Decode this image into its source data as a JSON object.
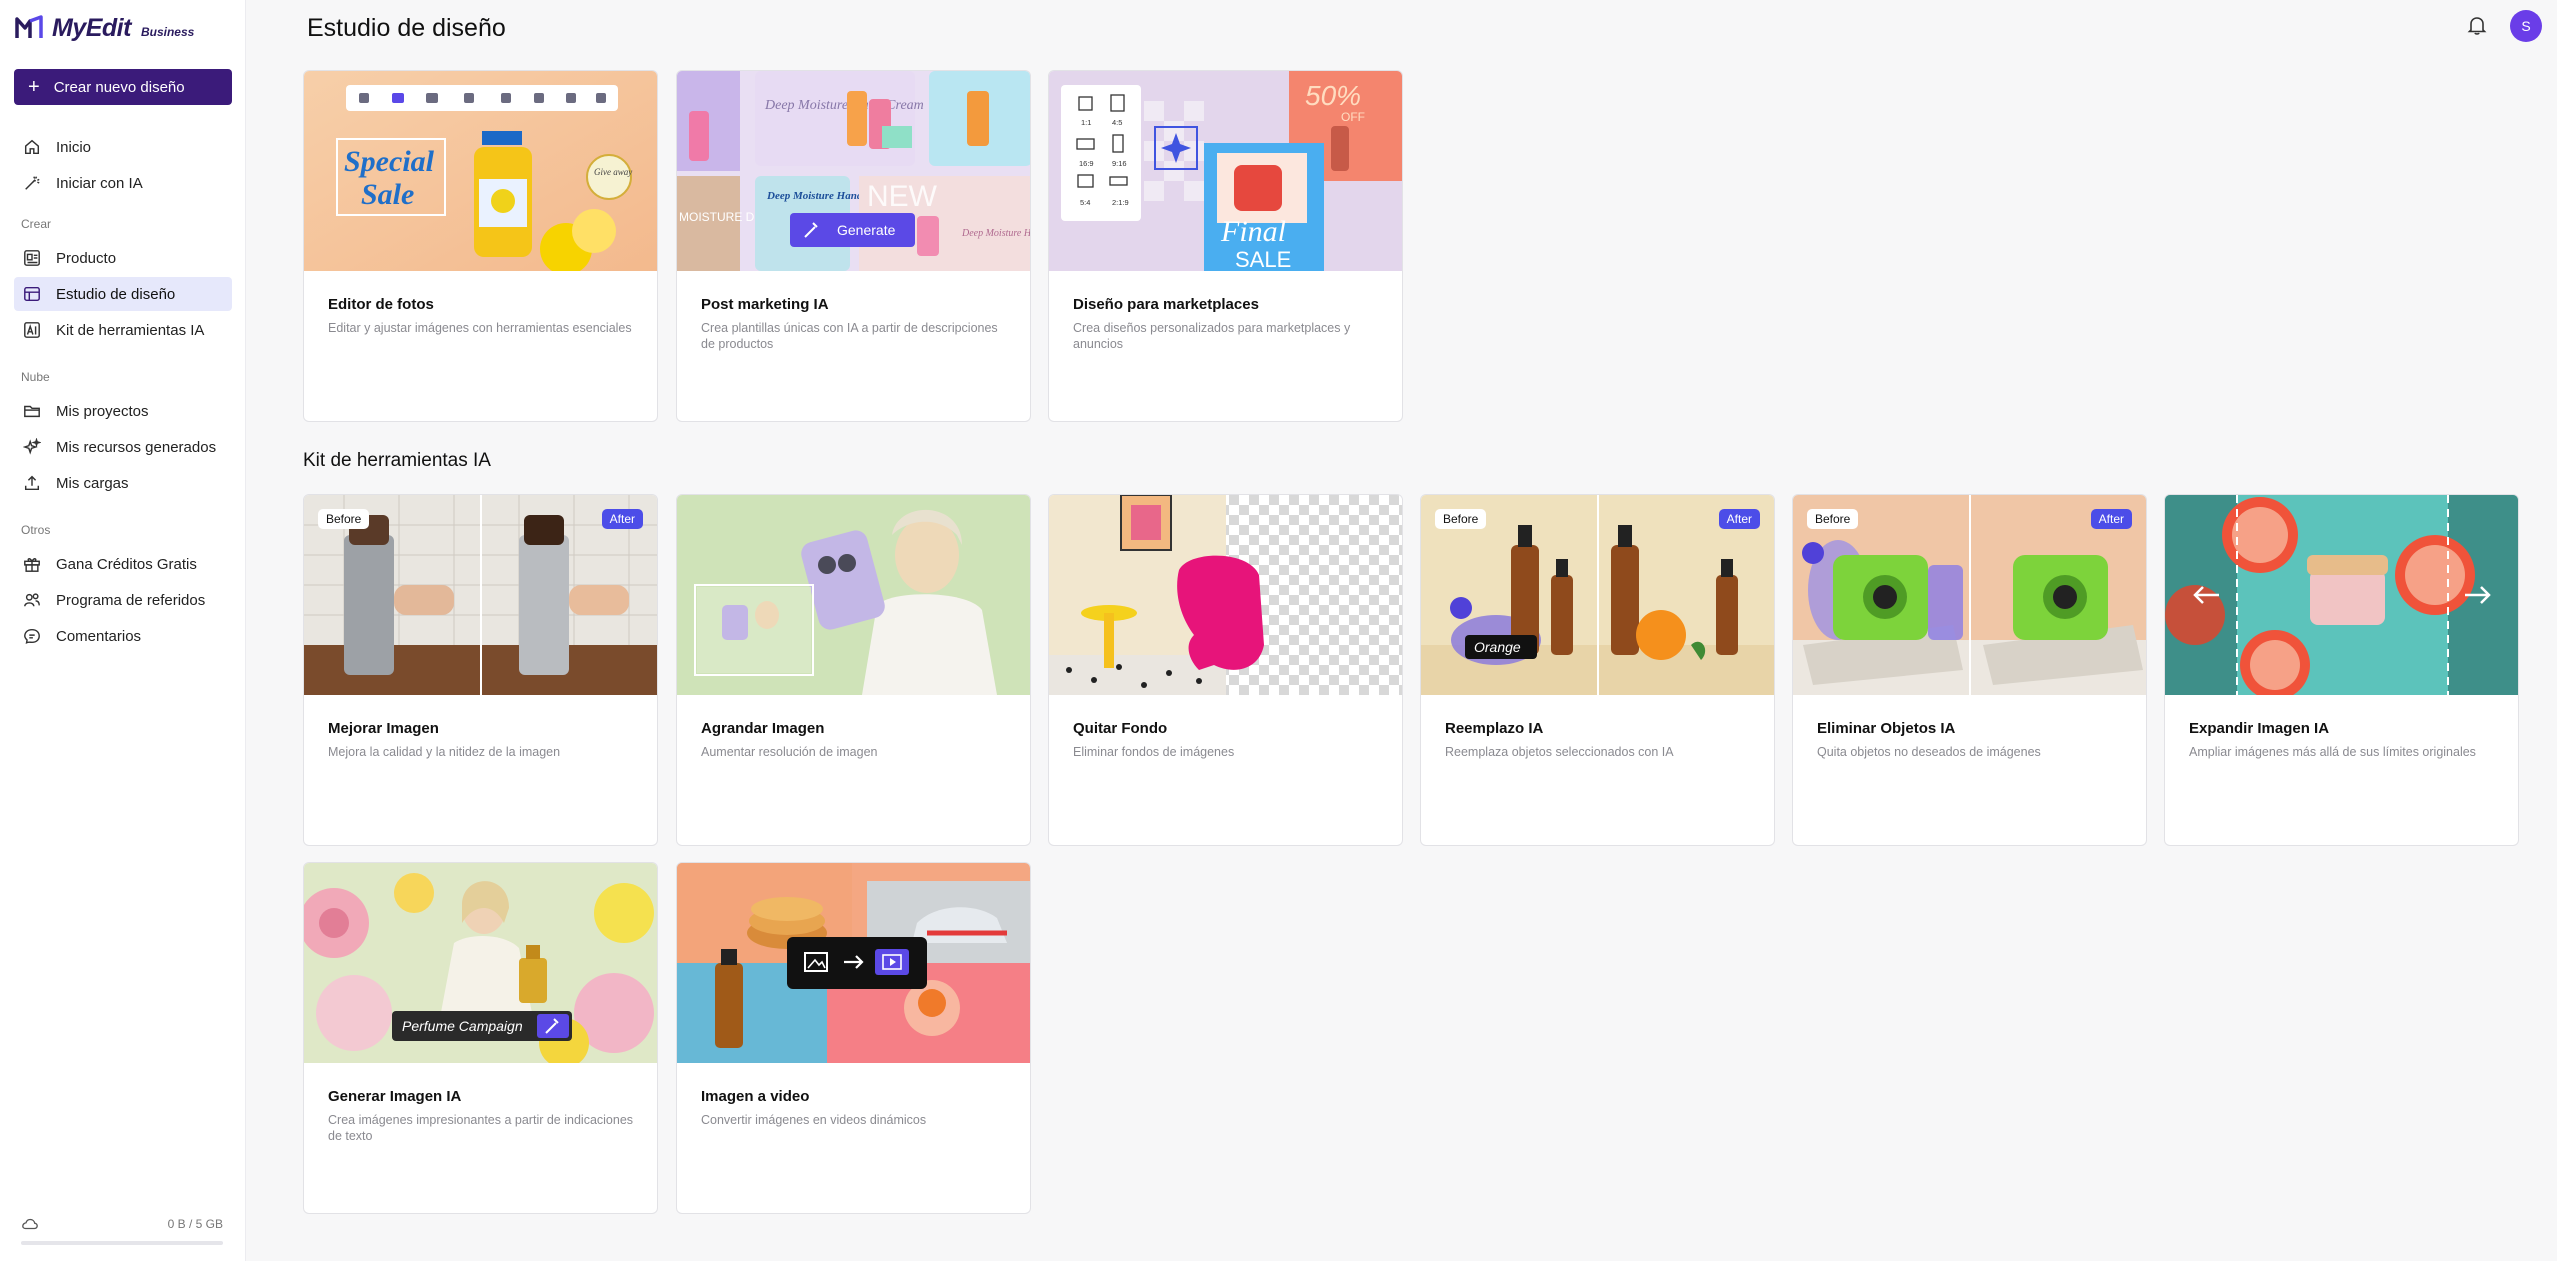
{
  "app": {
    "name": "MyEdit",
    "edition": "Business"
  },
  "sidebar": {
    "create_label": "Crear nuevo diseño",
    "items": [
      {
        "label": "Inicio",
        "icon": "home-icon"
      },
      {
        "label": "Iniciar con IA",
        "icon": "magic-wand-icon"
      }
    ],
    "sections": [
      {
        "title": "Crear",
        "items": [
          {
            "label": "Producto",
            "icon": "product-icon"
          },
          {
            "label": "Estudio de diseño",
            "icon": "design-studio-icon",
            "active": true
          },
          {
            "label": "Kit de herramientas IA",
            "icon": "ai-toolkit-icon"
          }
        ]
      },
      {
        "title": "Nube",
        "items": [
          {
            "label": "Mis proyectos",
            "icon": "folder-icon"
          },
          {
            "label": "Mis recursos generados",
            "icon": "sparkle-icon"
          },
          {
            "label": "Mis cargas",
            "icon": "upload-icon"
          }
        ]
      },
      {
        "title": "Otros",
        "items": [
          {
            "label": "Gana Créditos Gratis",
            "icon": "gift-icon"
          },
          {
            "label": "Programa de referidos",
            "icon": "users-icon"
          },
          {
            "label": "Comentarios",
            "icon": "comment-icon"
          }
        ]
      }
    ],
    "storage": "0 B / 5 GB",
    "storage_used_fraction": 0
  },
  "header": {
    "title": "Estudio de diseño",
    "avatar_letter": "S"
  },
  "design_studio": [
    {
      "title": "Editor de fotos",
      "desc": "Editar y ajustar imágenes con herramientas esenciales",
      "img": {
        "sale_word1": "Special",
        "sale_word2": "Sale",
        "badge": "Give away"
      }
    },
    {
      "title": "Post marketing IA",
      "desc": "Crea plantillas únicas con IA a partir de descripciones de productos",
      "img": {
        "card1": "Deep Moisture Hand Cream",
        "card2": "Deep Moisture Hand Cream",
        "card3": "NEW",
        "card4": "Deep Moisture Hand Cream",
        "side": "MOISTURE D CREAM",
        "button": "Generate"
      }
    },
    {
      "title": "Diseño para marketplaces",
      "desc": "Crea diseños personalizados para marketplaces y anuncios",
      "img": {
        "ratios": [
          "1:1",
          "4:5",
          "16:9",
          "9:16",
          "5:4",
          "2:1:9"
        ],
        "promo": "50%",
        "promo2": "OFF",
        "final1": "Final",
        "final2": "SALE"
      }
    }
  ],
  "toolkit": {
    "title": "Kit de herramientas IA",
    "tags": {
      "before": "Before",
      "after": "After"
    },
    "items": [
      {
        "title": "Mejorar Imagen",
        "desc": "Mejora la calidad y la nitidez de la imagen"
      },
      {
        "title": "Agrandar Imagen",
        "desc": "Aumentar resolución de imagen"
      },
      {
        "title": "Quitar Fondo",
        "desc": "Eliminar fondos de imágenes"
      },
      {
        "title": "Reemplazo IA",
        "desc": "Reemplaza objetos seleccionados con IA",
        "img_label": "Orange"
      },
      {
        "title": "Eliminar Objetos IA",
        "desc": "Quita objetos no deseados de imágenes"
      },
      {
        "title": "Expandir Imagen IA",
        "desc": "Ampliar imágenes más allá de sus límites originales"
      },
      {
        "title": "Generar Imagen IA",
        "desc": "Crea imágenes impresionantes a partir de indicaciones de texto",
        "img_label": "Perfume Campaign"
      },
      {
        "title": "Imagen a video",
        "desc": "Convertir imágenes en videos dinámicos"
      }
    ]
  },
  "colors": {
    "brand": "#3b1b7a",
    "accent": "#4c4de8",
    "active_bg": "#e6e8fb",
    "avatar": "#6a3de8"
  }
}
